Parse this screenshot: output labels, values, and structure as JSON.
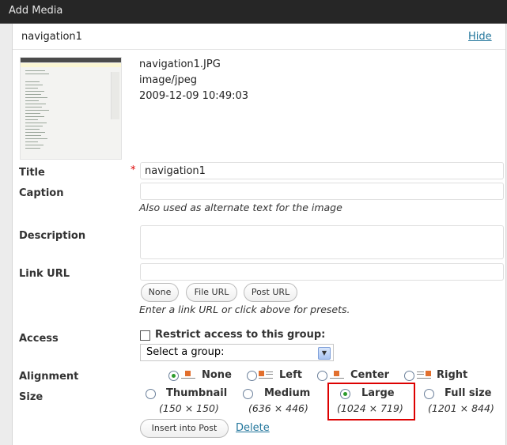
{
  "window": {
    "title": "Add Media"
  },
  "header": {
    "name": "navigation1",
    "hide_label": "Hide"
  },
  "file": {
    "filename": "navigation1.JPG",
    "mime": "image/jpeg",
    "date": "2009-12-09 10:49:03"
  },
  "form": {
    "title": {
      "label": "Title",
      "value": "navigation1",
      "required": "*"
    },
    "caption": {
      "label": "Caption",
      "value": "",
      "help": "Also used as alternate text for the image"
    },
    "description": {
      "label": "Description",
      "value": ""
    },
    "link": {
      "label": "Link URL",
      "value": "",
      "buttons": {
        "none": "None",
        "file_url": "File URL",
        "post_url": "Post URL"
      },
      "help": "Enter a link URL or click above for presets."
    },
    "access": {
      "label": "Access",
      "checkbox_label": "Restrict access to this group:",
      "select_value": "Select a group:"
    },
    "alignment": {
      "label": "Alignment",
      "options": {
        "none": "None",
        "left": "Left",
        "center": "Center",
        "right": "Right"
      },
      "selected": "None"
    },
    "size": {
      "label": "Size",
      "thumbnail": {
        "label": "Thumbnail",
        "dims": "(150 × 150)"
      },
      "medium": {
        "label": "Medium",
        "dims": "(636 × 446)"
      },
      "large": {
        "label": "Large",
        "dims": "(1024 × 719)"
      },
      "full": {
        "label": "Full size",
        "dims": "(1201 × 844)"
      },
      "selected": "Large"
    }
  },
  "actions": {
    "insert": "Insert into Post",
    "delete": "Delete"
  }
}
